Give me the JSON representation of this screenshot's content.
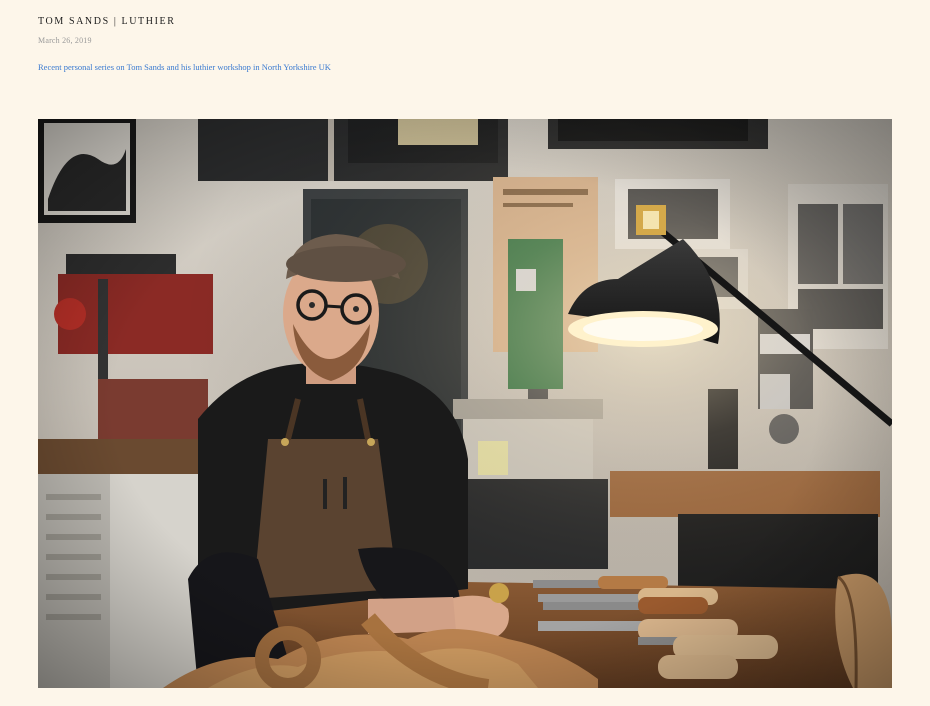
{
  "post": {
    "title": "TOM SANDS | LUTHIER",
    "date": "March 26, 2019",
    "description": "Recent personal series on Tom Sands and his luthier workshop in North Yorkshire UK"
  },
  "photo": {
    "subject": "luthier-portrait",
    "palette": {
      "background": "#fdf6ea",
      "link": "#3a7ad0",
      "lamp_glow": "#fff4d6",
      "wood": "#c08a55"
    }
  }
}
